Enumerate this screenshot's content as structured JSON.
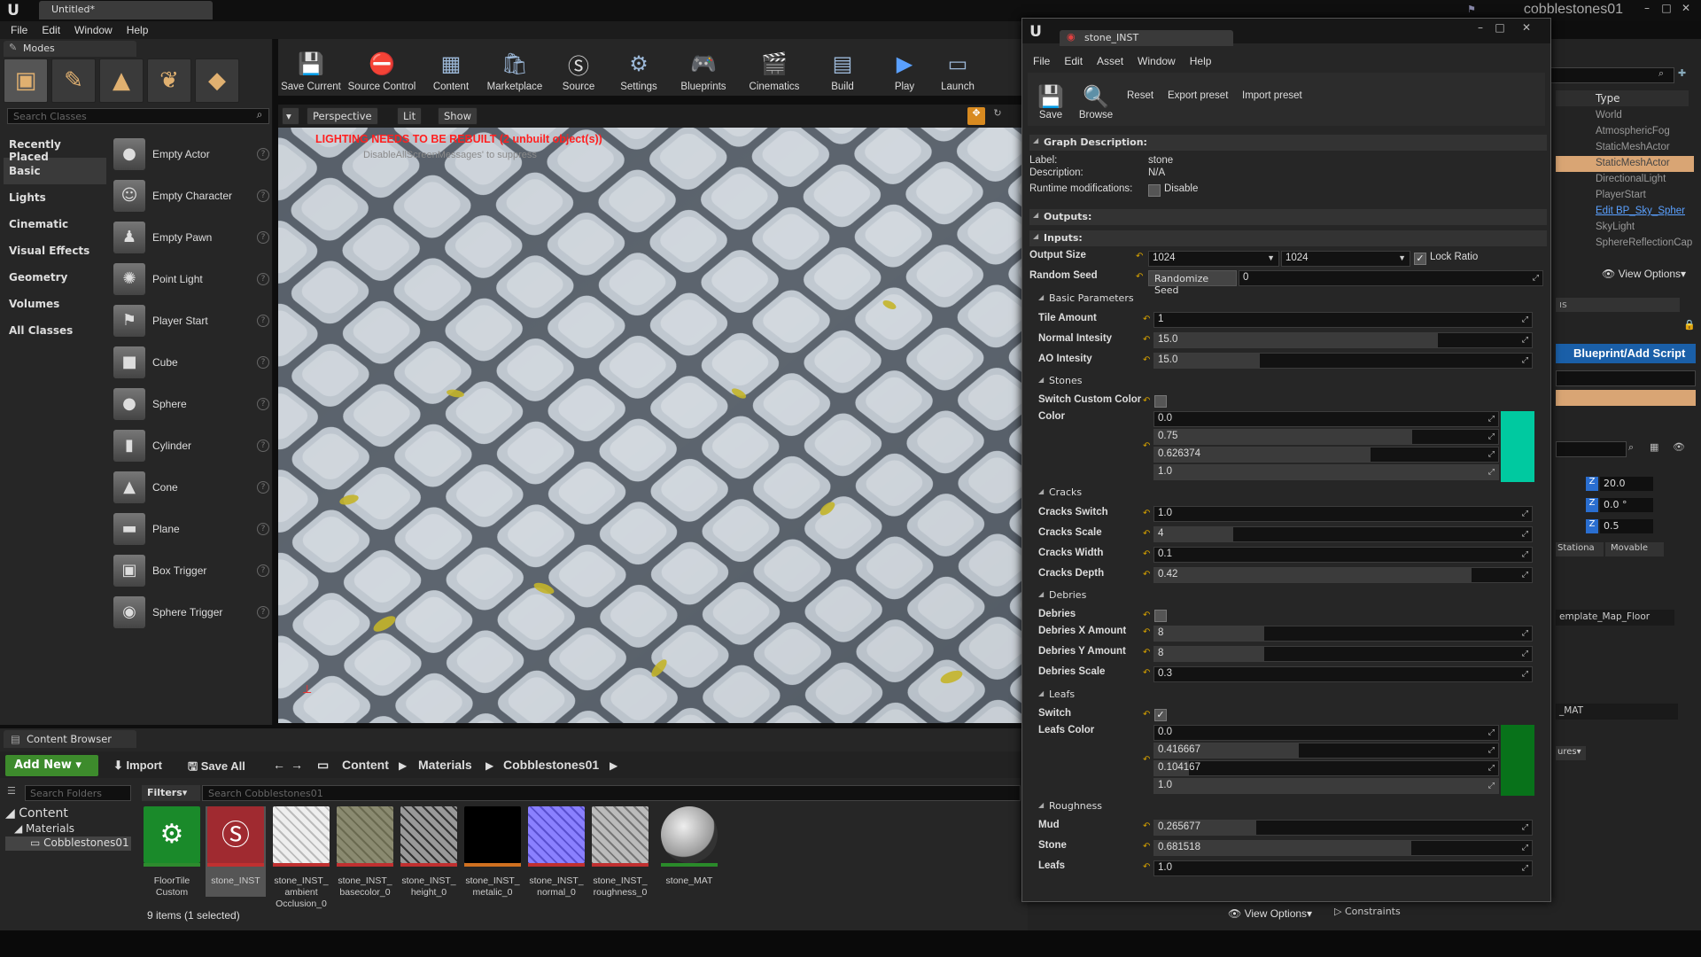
{
  "app": {
    "doc_tab": "Untitled*",
    "project_name": "cobblestones01",
    "menu": [
      "File",
      "Edit",
      "Window",
      "Help"
    ],
    "min": "–",
    "max": "□",
    "close": "✕"
  },
  "modes": {
    "tab_label": "Modes",
    "search_placeholder": "Search Classes",
    "categories": [
      "Recently Placed",
      "Basic",
      "Lights",
      "Cinematic",
      "Visual Effects",
      "Geometry",
      "Volumes",
      "All Classes"
    ],
    "selected_category": "Basic",
    "items": [
      "Empty Actor",
      "Empty Character",
      "Empty Pawn",
      "Point Light",
      "Player Start",
      "Cube",
      "Sphere",
      "Cylinder",
      "Cone",
      "Plane",
      "Box Trigger",
      "Sphere Trigger"
    ],
    "help_glyph": "?"
  },
  "toolbar": {
    "buttons": [
      "Save Current",
      "Source Control",
      "Content",
      "Marketplace",
      "Source",
      "Settings",
      "Blueprints",
      "Cinematics",
      "Build",
      "Play",
      "Launch"
    ]
  },
  "viewport": {
    "dropdown_arrow": "▾",
    "perspective": "Perspective",
    "lit": "Lit",
    "show": "Show",
    "warning": "LIGHTING NEEDS TO BE REBUILT (2 unbuilt object(s))",
    "sub_message": "DisableAllScreenMessages' to suppress"
  },
  "content_browser": {
    "tab_label": "Content Browser",
    "add_new": "Add New ▾",
    "import": "Import",
    "save_all": "Save All",
    "breadcrumbs": [
      "Content",
      "Materials",
      "Cobblestones01"
    ],
    "search_folders_placeholder": "Search Folders",
    "filters": "Filters▾",
    "search_placeholder": "Search Cobblestones01",
    "tree": [
      "Content",
      "Materials",
      "Cobblestones01"
    ],
    "assets": [
      {
        "label": "FloorTile Custom",
        "bar": "#2e8b2e"
      },
      {
        "label": "stone_INST",
        "bar": "#a03030"
      },
      {
        "label": "stone_INST_ ambient Occlusion_0",
        "bar": "#2a5"
      },
      {
        "label": "stone_INST_ basecolor_0",
        "bar": "#2a5"
      },
      {
        "label": "stone_INST_ height_0",
        "bar": "#2a5"
      },
      {
        "label": "stone_INST_ metalic_0",
        "bar": "#d07020"
      },
      {
        "label": "stone_INST_ normal_0",
        "bar": "#2a5"
      },
      {
        "label": "stone_INST_ roughness_0",
        "bar": "#2a5"
      },
      {
        "label": "stone_MAT",
        "bar": "#2a8a2a"
      }
    ],
    "status": "9 items (1 selected)",
    "view_options": "View Options▾"
  },
  "outliner": {
    "type_header": "Type",
    "rows": [
      "World",
      "AtmosphericFog",
      "StaticMeshActor",
      "StaticMeshActor",
      "DirectionalLight",
      "PlayerStart",
      "Edit BP_Sky_Spher",
      "SkyLight",
      "SphereReflectionCap"
    ],
    "view_options": "View Options▾",
    "tab_stub": "ıs"
  },
  "details_behind": {
    "blueprint_button": "Blueprint/Add Script",
    "z_label": "Z",
    "z_values": [
      "20.0",
      "0.0 °",
      "0.5"
    ],
    "mobility": [
      "Stationa",
      "Movable"
    ],
    "map_floor": "emplate_Map_Floor",
    "mat": "_MAT",
    "ures": "ures▾",
    "constraints": "Constraints"
  },
  "material_window": {
    "tab_label": "stone_INST",
    "menu": [
      "File",
      "Edit",
      "Asset",
      "Window",
      "Help"
    ],
    "tools": {
      "save": "Save",
      "browse": "Browse",
      "reset": "Reset",
      "export": "Export preset",
      "import": "Import preset"
    },
    "graph_description": {
      "header": "Graph Description:",
      "label_key": "Label:",
      "label_val": "stone",
      "desc_key": "Description:",
      "desc_val": "N/A",
      "runtime_key": "Runtime modifications:",
      "runtime_val": "Disable"
    },
    "outputs_header": "Outputs:",
    "inputs_header": "Inputs:",
    "output_size": {
      "label": "Output Size",
      "w": "1024",
      "h": "1024",
      "lock": "Lock Ratio"
    },
    "random_seed": {
      "label": "Random Seed",
      "button": "Randomize Seed",
      "value": "0"
    },
    "groups": {
      "basic": "Basic Parameters",
      "stones": "Stones",
      "cracks": "Cracks",
      "debries": "Debries",
      "leafs": "Leafs",
      "roughness": "Roughness"
    },
    "params": {
      "tile_amount": {
        "label": "Tile Amount",
        "value": "1",
        "fill": 0.0
      },
      "normal_intensity": {
        "label": "Normal Intesity",
        "value": "15.0",
        "fill": 0.75
      },
      "ao_intensity": {
        "label": "AO Intesity",
        "value": "15.0",
        "fill": 0.28
      },
      "switch_custom_color": {
        "label": "Switch Custom Color"
      },
      "color": {
        "label": "Color",
        "values": [
          "0.0",
          "0.75",
          "0.626374",
          "1.0"
        ],
        "fills": [
          0.0,
          0.75,
          0.63,
          1.0
        ],
        "swatch": "#00c9a0"
      },
      "cracks_switch": {
        "label": "Cracks Switch",
        "value": "1.0",
        "fill": 0.0
      },
      "cracks_scale": {
        "label": "Cracks Scale",
        "value": "4",
        "fill": 0.21
      },
      "cracks_width": {
        "label": "Cracks Width",
        "value": "0.1",
        "fill": 0.0
      },
      "cracks_depth": {
        "label": "Cracks Depth",
        "value": "0.42",
        "fill": 0.84
      },
      "debries": {
        "label": "Debries"
      },
      "debries_x": {
        "label": "Debries X Amount",
        "value": "8",
        "fill": 0.29
      },
      "debries_y": {
        "label": "Debries Y Amount",
        "value": "8",
        "fill": 0.29
      },
      "debries_scale": {
        "label": "Debries Scale",
        "value": "0.3",
        "fill": 0.0
      },
      "leafs_switch": {
        "label": "Switch"
      },
      "leafs_color": {
        "label": "Leafs Color",
        "values": [
          "0.0",
          "0.416667",
          "0.104167",
          "1.0"
        ],
        "fills": [
          0.0,
          0.42,
          0.1,
          1.0
        ],
        "swatch": "#08721a"
      },
      "mud": {
        "label": "Mud",
        "value": "0.265677",
        "fill": 0.27
      },
      "stone": {
        "label": "Stone",
        "value": "0.681518",
        "fill": 0.68
      },
      "leafs": {
        "label": "Leafs",
        "value": "1.0",
        "fill": 0.0
      }
    }
  }
}
